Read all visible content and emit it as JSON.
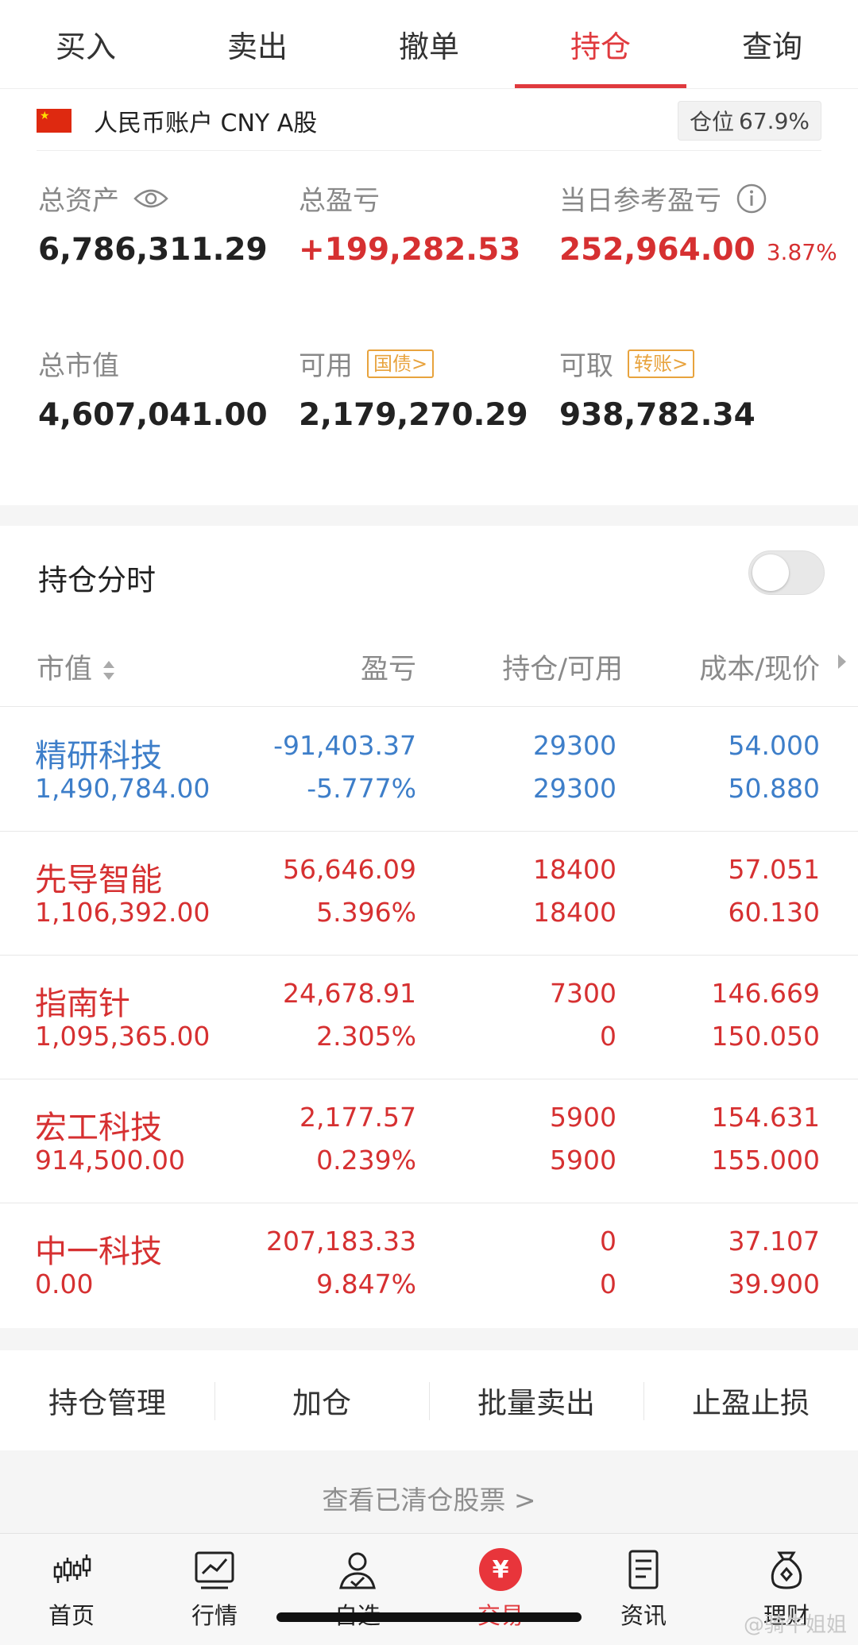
{
  "tabs": [
    {
      "label": "买入"
    },
    {
      "label": "卖出"
    },
    {
      "label": "撤单"
    },
    {
      "label": "持仓",
      "active": true
    },
    {
      "label": "查询"
    }
  ],
  "account": {
    "label": "人民币账户 CNY A股",
    "position_label": "仓位",
    "position_value": "67.9%"
  },
  "summary": {
    "total_assets": {
      "label": "总资产",
      "value": "6,786,311.29"
    },
    "total_pl": {
      "label": "总盈亏",
      "value": "+199,282.53"
    },
    "daily_pl": {
      "label": "当日参考盈亏",
      "value": "252,964.00",
      "percent": "3.87%"
    },
    "market_value": {
      "label": "总市值",
      "value": "4,607,041.00"
    },
    "available": {
      "label": "可用",
      "tag": "国债>",
      "value": "2,179,270.29"
    },
    "withdrawable": {
      "label": "可取",
      "tag": "转账>",
      "value": "938,782.34"
    }
  },
  "holdings": {
    "title": "持仓分时",
    "toggle_on": false,
    "headers": {
      "market_value": "市值",
      "pl": "盈亏",
      "hold": "持仓/可用",
      "cost": "成本/现价"
    },
    "rows": [
      {
        "name": "精研科技",
        "market_value": "1,490,784.00",
        "pl": "-91,403.37",
        "pl_pct": "-5.777%",
        "hold": "29300",
        "avail": "29300",
        "cost": "54.000",
        "price": "50.880",
        "color": "#3d7ec9"
      },
      {
        "name": "先导智能",
        "market_value": "1,106,392.00",
        "pl": "56,646.09",
        "pl_pct": "5.396%",
        "hold": "18400",
        "avail": "18400",
        "cost": "57.051",
        "price": "60.130",
        "color": "#d63031"
      },
      {
        "name": "指南针",
        "market_value": "1,095,365.00",
        "pl": "24,678.91",
        "pl_pct": "2.305%",
        "hold": "7300",
        "avail": "0",
        "cost": "146.669",
        "price": "150.050",
        "color": "#d63031"
      },
      {
        "name": "宏工科技",
        "market_value": "914,500.00",
        "pl": "2,177.57",
        "pl_pct": "0.239%",
        "hold": "5900",
        "avail": "5900",
        "cost": "154.631",
        "price": "155.000",
        "color": "#d63031"
      },
      {
        "name": "中一科技",
        "market_value": "0.00",
        "pl": "207,183.33",
        "pl_pct": "9.847%",
        "hold": "0",
        "avail": "0",
        "cost": "37.107",
        "price": "39.900",
        "color": "#d63031"
      }
    ]
  },
  "actions": [
    {
      "label": "持仓管理"
    },
    {
      "label": "加仓"
    },
    {
      "label": "批量卖出"
    },
    {
      "label": "止盈止损"
    }
  ],
  "cleared_link": "查看已清仓股票 >",
  "bottom_nav": [
    {
      "label": "首页",
      "icon": "candlestick-icon"
    },
    {
      "label": "行情",
      "icon": "chart-icon"
    },
    {
      "label": "自选",
      "icon": "person-check-icon"
    },
    {
      "label": "交易",
      "icon": "yuan-badge-icon",
      "active": true
    },
    {
      "label": "资讯",
      "icon": "document-icon"
    },
    {
      "label": "理财",
      "icon": "money-bag-icon"
    }
  ],
  "watermark": "@骑牛姐姐"
}
